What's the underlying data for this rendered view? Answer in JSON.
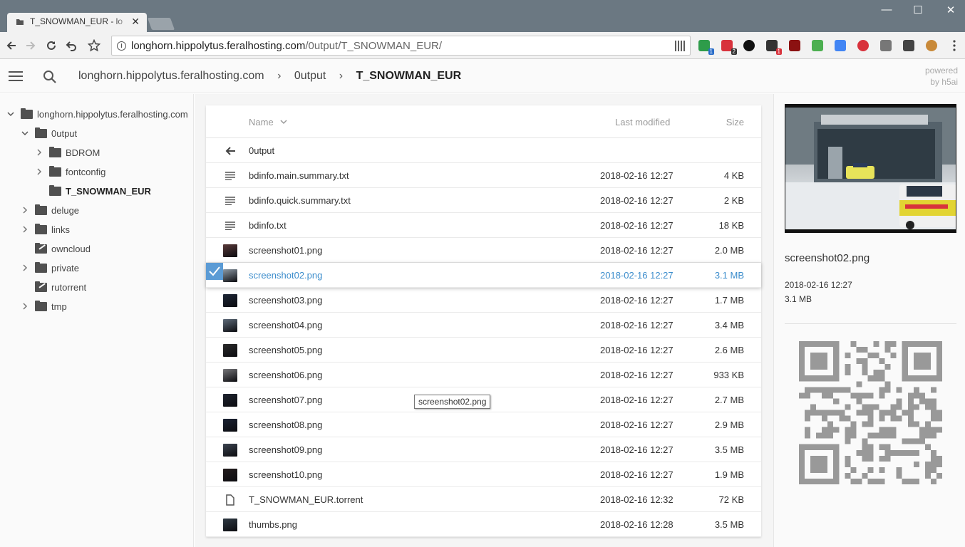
{
  "browser": {
    "tab_title": "T_SNOWMAN_EUR - lo",
    "url_host": "longhorn.hippolytus.feralhosting.com",
    "url_path": "/0utput/T_SNOWMAN_EUR/",
    "extension_badges": [
      "1",
      "2",
      "1"
    ]
  },
  "topbar": {
    "crumbs": [
      "longhorn.hippolytus.feralhosting.com",
      "0utput",
      "T_SNOWMAN_EUR"
    ],
    "powered_line1": "powered",
    "powered_line2": "by h5ai"
  },
  "tree": [
    {
      "label": "longhorn.hippolytus.feralhosting.com",
      "expanded": true,
      "type": "folder",
      "depth": 0
    },
    {
      "label": "0utput",
      "expanded": true,
      "type": "folder",
      "depth": 1
    },
    {
      "label": "BDROM",
      "expanded": false,
      "type": "folder",
      "depth": 2
    },
    {
      "label": "fontconfig",
      "expanded": false,
      "type": "folder",
      "depth": 2
    },
    {
      "label": "T_SNOWMAN_EUR",
      "expanded": null,
      "type": "folder",
      "depth": 2,
      "current": true
    },
    {
      "label": "deluge",
      "expanded": false,
      "type": "folder",
      "depth": 1
    },
    {
      "label": "links",
      "expanded": false,
      "type": "folder",
      "depth": 1
    },
    {
      "label": "owncloud",
      "expanded": null,
      "type": "link",
      "depth": 1
    },
    {
      "label": "private",
      "expanded": false,
      "type": "folder",
      "depth": 1
    },
    {
      "label": "rutorrent",
      "expanded": null,
      "type": "link",
      "depth": 1
    },
    {
      "label": "tmp",
      "expanded": false,
      "type": "folder",
      "depth": 1
    }
  ],
  "list": {
    "headers": {
      "name": "Name",
      "modified": "Last modified",
      "size": "Size"
    },
    "parent": "0utput",
    "items": [
      {
        "name": "bdinfo.main.summary.txt",
        "date": "2018-02-16 12:27",
        "size": "4 KB",
        "kind": "text"
      },
      {
        "name": "bdinfo.quick.summary.txt",
        "date": "2018-02-16 12:27",
        "size": "2 KB",
        "kind": "text"
      },
      {
        "name": "bdinfo.txt",
        "date": "2018-02-16 12:27",
        "size": "18 KB",
        "kind": "text"
      },
      {
        "name": "screenshot01.png",
        "date": "2018-02-16 12:27",
        "size": "2.0 MB",
        "kind": "image",
        "thumb": "#5b3a3a"
      },
      {
        "name": "screenshot02.png",
        "date": "2018-02-16 12:27",
        "size": "3.1 MB",
        "kind": "image",
        "thumb": "#8d9aa6",
        "selected": true
      },
      {
        "name": "screenshot03.png",
        "date": "2018-02-16 12:27",
        "size": "1.7 MB",
        "kind": "image",
        "thumb": "#1d2636"
      },
      {
        "name": "screenshot04.png",
        "date": "2018-02-16 12:27",
        "size": "3.4 MB",
        "kind": "image",
        "thumb": "#5f6c7a"
      },
      {
        "name": "screenshot05.png",
        "date": "2018-02-16 12:27",
        "size": "2.6 MB",
        "kind": "image",
        "thumb": "#2b2b2b"
      },
      {
        "name": "screenshot06.png",
        "date": "2018-02-16 12:27",
        "size": "933 KB",
        "kind": "image",
        "thumb": "#77777a"
      },
      {
        "name": "screenshot07.png",
        "date": "2018-02-16 12:27",
        "size": "2.7 MB",
        "kind": "image",
        "thumb": "#1f2430"
      },
      {
        "name": "screenshot08.png",
        "date": "2018-02-16 12:27",
        "size": "2.9 MB",
        "kind": "image",
        "thumb": "#1a2233"
      },
      {
        "name": "screenshot09.png",
        "date": "2018-02-16 12:27",
        "size": "3.5 MB",
        "kind": "image",
        "thumb": "#3c4450"
      },
      {
        "name": "screenshot10.png",
        "date": "2018-02-16 12:27",
        "size": "1.9 MB",
        "kind": "image",
        "thumb": "#221c1c"
      },
      {
        "name": "T_SNOWMAN_EUR.torrent",
        "date": "2018-02-16 12:32",
        "size": "72 KB",
        "kind": "file"
      },
      {
        "name": "thumbs.png",
        "date": "2018-02-16 12:28",
        "size": "3.5 MB",
        "kind": "image",
        "thumb": "#2f3a44"
      }
    ]
  },
  "tooltip": "screenshot02.png",
  "info": {
    "name": "screenshot02.png",
    "date": "2018-02-16 12:27",
    "size": "3.1 MB"
  },
  "colors": {
    "accent": "#3c8dcc",
    "titlebar": "#6b7882"
  }
}
